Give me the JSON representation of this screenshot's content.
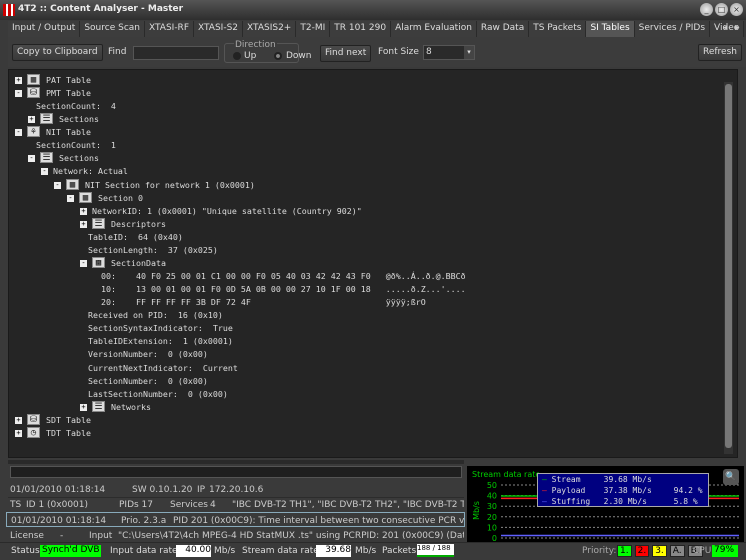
{
  "window": {
    "title": "4T2 :: Content Analyser - Master"
  },
  "tabs": [
    "Input / Output",
    "Source Scan",
    "XTASI-RF",
    "XTASI-S2",
    "XTASIS2+",
    "T2-MI",
    "TR 101 290",
    "Alarm Evaluation",
    "Raw Data",
    "TS Packets",
    "SI Tables",
    "Services / PIDs",
    "Video"
  ],
  "active_tab": "SI Tables",
  "toolbar": {
    "copy": "Copy to Clipboard",
    "find_label": "Find",
    "find_value": "",
    "direction_label": "Direction",
    "up": "Up",
    "down": "Down",
    "direction_selected": "Down",
    "find_next": "Find next",
    "font_size_label": "Font Size",
    "font_size": "8",
    "refresh": "Refresh"
  },
  "tree": [
    {
      "l": 0,
      "exp": "+",
      "icon": "table",
      "t": "PAT Table"
    },
    {
      "l": 0,
      "exp": "-",
      "icon": "database",
      "t": "PMT Table"
    },
    {
      "l": 1,
      "t": "SectionCount:  4"
    },
    {
      "l": 1,
      "exp": "+",
      "icon": "list",
      "t": "Sections"
    },
    {
      "l": 0,
      "exp": "-",
      "icon": "network",
      "t": "NIT Table"
    },
    {
      "l": 1,
      "t": "SectionCount:  1"
    },
    {
      "l": 1,
      "exp": "-",
      "icon": "list",
      "t": "Sections"
    },
    {
      "l": 2,
      "exp": "-",
      "t": "Network: Actual"
    },
    {
      "l": 3,
      "exp": "-",
      "icon": "table",
      "t": "NIT Section for network 1 (0x0001)"
    },
    {
      "l": 4,
      "exp": "-",
      "icon": "table",
      "t": "Section 0"
    },
    {
      "l": 5,
      "exp": "+",
      "t": "NetworkID: 1 (0x0001) \"Unique satellite (Country 902)\""
    },
    {
      "l": 5,
      "exp": "+",
      "icon": "list",
      "t": "Descriptors"
    },
    {
      "l": 5,
      "t": "TableID:  64 (0x40)"
    },
    {
      "l": 5,
      "t": "SectionLength:  37 (0x025)"
    },
    {
      "l": 5,
      "exp": "-",
      "icon": "grid",
      "t": "SectionData"
    },
    {
      "l": 6,
      "t": "00:    40 F0 25 00 01 C1 00 00 F0 05 40 03 42 42 43 F0   @ð%..Á..ð.@.BBCð"
    },
    {
      "l": 6,
      "t": "10:    13 00 01 00 01 F0 0D 5A 0B 00 00 27 10 1F 00 18   .....ð.Z...'...."
    },
    {
      "l": 6,
      "t": "20:    FF FF FF FF 3B DF 72 4F                           ÿÿÿÿ;ßrO"
    },
    {
      "l": 5,
      "t": "Received on PID:  16 (0x10)"
    },
    {
      "l": 5,
      "t": "SectionSyntaxIndicator:  True"
    },
    {
      "l": 5,
      "t": "TableIDExtension:  1 (0x0001)"
    },
    {
      "l": 5,
      "t": "VersionNumber:  0 (0x00)"
    },
    {
      "l": 5,
      "t": "CurrentNextIndicator:  Current"
    },
    {
      "l": 5,
      "t": "SectionNumber:  0 (0x00)"
    },
    {
      "l": 5,
      "t": "LastSectionNumber:  0 (0x00)"
    },
    {
      "l": 5,
      "exp": "+",
      "icon": "list",
      "t": "Networks"
    },
    {
      "l": 0,
      "exp": "+",
      "icon": "database",
      "t": "SDT Table"
    },
    {
      "l": 0,
      "exp": "+",
      "icon": "clock",
      "t": "TDT Table"
    }
  ],
  "info": {
    "r1": {
      "date": "01/01/2010 01:18:14",
      "sw": "SW 0.10.1.20",
      "ip_label": "IP",
      "ip": "172.20.10.6"
    },
    "r2": {
      "ts": "TS",
      "id": "ID 1 (0x0001)",
      "pids": "PIDs 17",
      "services_label": "Services",
      "services": "4",
      "names": "\"IBC DVB-T2 TH1\", \"IBC DVB-T2 TH2\", \"IBC DVB-T2 TH"
    },
    "r3": {
      "date": "01/01/2010 01:18:14",
      "prio": "Prio. 2.3.a",
      "msg": "PID 201 (0x00C9): Time interval between two consecutive PCR values"
    },
    "r4": {
      "license": "License",
      "license_val": "-",
      "input_label": "Input",
      "input": "\"C:\\Users\\4T2\\4ch MPEG-4 HD StatMUX .ts\" using PCRPID: 201 (0x00C9) (Data rate"
    }
  },
  "status": {
    "label": "Status",
    "value": "Synch'd DVB",
    "input_rate_label": "Input data rate",
    "input_rate": "40.00",
    "unit": "Mb/s",
    "stream_rate_label": "Stream data rate",
    "stream_rate": "39.68",
    "packets_label": "Packets",
    "packets": "188 / 188",
    "priority_label": "Priority:",
    "priorities": [
      "1.",
      "2.",
      "3.",
      "A.",
      "B."
    ],
    "cpu_label": "CPU",
    "cpu": "79%"
  },
  "chart_data": {
    "type": "line",
    "title": "Stream data rate",
    "ylabel": "Mb/s",
    "ylim": [
      0,
      50
    ],
    "yticks": [
      "50",
      "40",
      "30",
      "20",
      "10",
      "0"
    ],
    "grid": true,
    "series": [
      {
        "name": "Stream",
        "value": "39.68 Mb/s",
        "pct": "",
        "y": 39.68,
        "color": "#00c000"
      },
      {
        "name": "Payload",
        "value": "37.38 Mb/s",
        "pct": "94.2 %",
        "y": 37.38,
        "color": "#ff2020"
      },
      {
        "name": "Stuffing",
        "value": "2.30 Mb/s",
        "pct": "5.8 %",
        "y": 2.3,
        "color": "#6060ff"
      }
    ]
  },
  "colors": {
    "sync": "#00ff00",
    "p1": "#00ff00",
    "p2": "#ff0000",
    "p3": "#ffff00",
    "pA": "#888888",
    "pB": "#888888",
    "cpu": "#00ff00"
  }
}
